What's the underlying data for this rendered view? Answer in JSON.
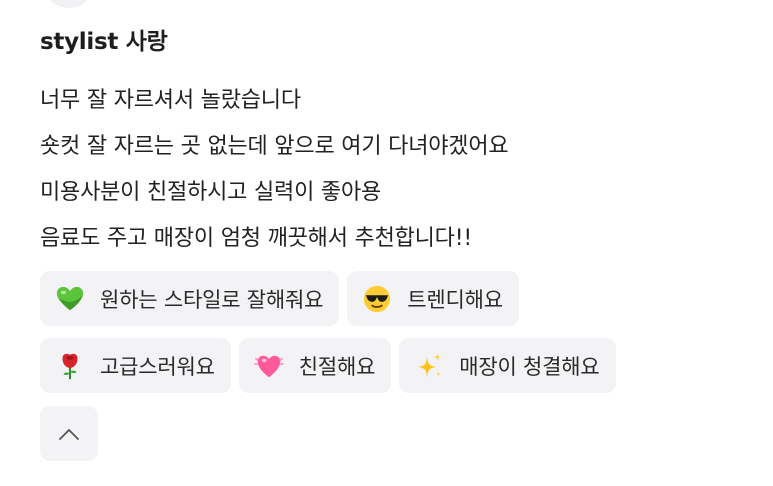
{
  "review": {
    "author": "stylist 사랑",
    "lines": [
      "너무 잘 자르셔서 놀랐습니다",
      "숏컷 잘 자르는 곳 없는데 앞으로 여기 다녀야겠어요",
      "미용사분이 친절하시고 실력이 좋아용",
      "음료도 주고 매장이 엄청 깨끗해서 추천합니다!!"
    ]
  },
  "keywords": {
    "row1": [
      {
        "icon": "green-heart-icon",
        "label": "원하는 스타일로 잘해줘요"
      },
      {
        "icon": "sunglasses-face-icon",
        "label": "트렌디해요"
      }
    ],
    "row2": [
      {
        "icon": "rose-icon",
        "label": "고급스러워요"
      },
      {
        "icon": "beating-heart-icon",
        "label": "친절해요"
      },
      {
        "icon": "sparkles-icon",
        "label": "매장이 청결해요"
      }
    ]
  },
  "collapse": {
    "icon": "chevron-up-icon"
  },
  "colors": {
    "chip_bg": "#f3f3f5",
    "text": "#222222",
    "green_heart": "#5cc43a",
    "emoji_yellow": "#ffcc33",
    "rose_red": "#d8232a",
    "pink_heart": "#ff5a9a",
    "sparkle_gold": "#ffc21a"
  }
}
